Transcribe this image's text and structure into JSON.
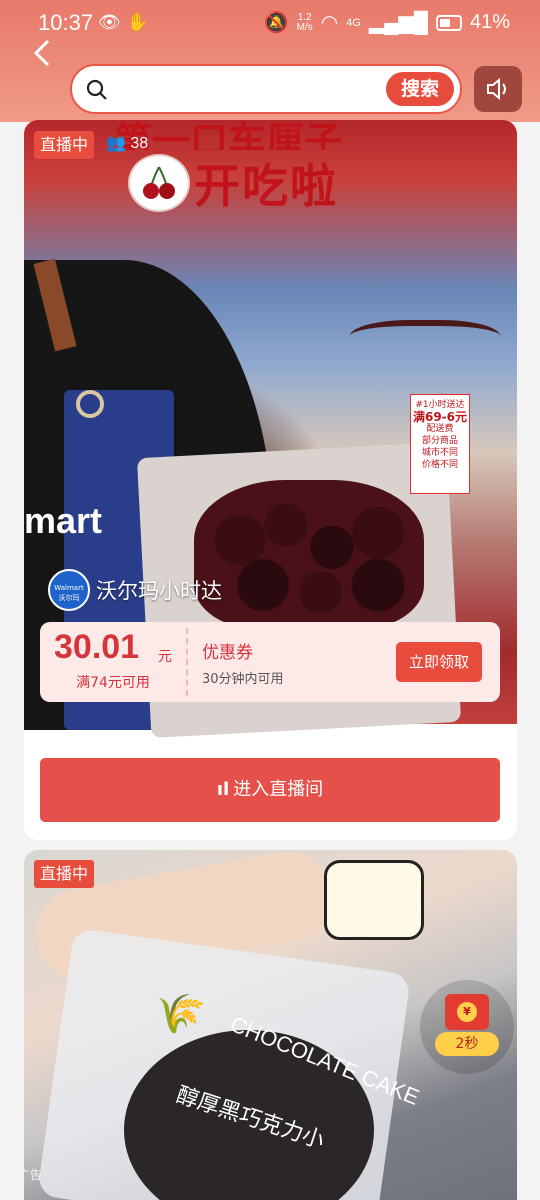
{
  "status_bar": {
    "time": "10:37",
    "net_speed_value": "1.2",
    "net_speed_unit": "M/s",
    "signal": "4G",
    "battery": "41%"
  },
  "header": {
    "search_placeholder": "",
    "search_button": "搜索"
  },
  "cards": [
    {
      "live_badge": "直播中",
      "viewers": "38",
      "banner_title": "开吃啦",
      "banner_top": "第一口车厘子",
      "store_name": "沃尔玛小时达",
      "store_logo_text": "Walmart 沃尔玛",
      "apron_text": "mart",
      "promo_sign": [
        "#1小时送达",
        "满69-6元",
        "配送费",
        "部分商品",
        "城市不同",
        "价格不同"
      ],
      "coupon": {
        "amount": "30.01",
        "unit": "元",
        "condition": "满74元可用",
        "title": "优惠券",
        "description": "30分钟内可用",
        "claim_button": "立即领取"
      },
      "enter_button": "进入直播间"
    },
    {
      "live_badge": "直播中",
      "product_text": "CHOCOLATE CAKE",
      "product_text_cn": "醇厚黑巧克力小",
      "ad_tag": "广告"
    }
  ],
  "floating_redpacket": {
    "coin": "¥",
    "timer": "2秒"
  },
  "colors": {
    "accent": "#e74c3c",
    "header_gradient_start": "#e8796a",
    "coupon_bg": "#fde9e8"
  }
}
